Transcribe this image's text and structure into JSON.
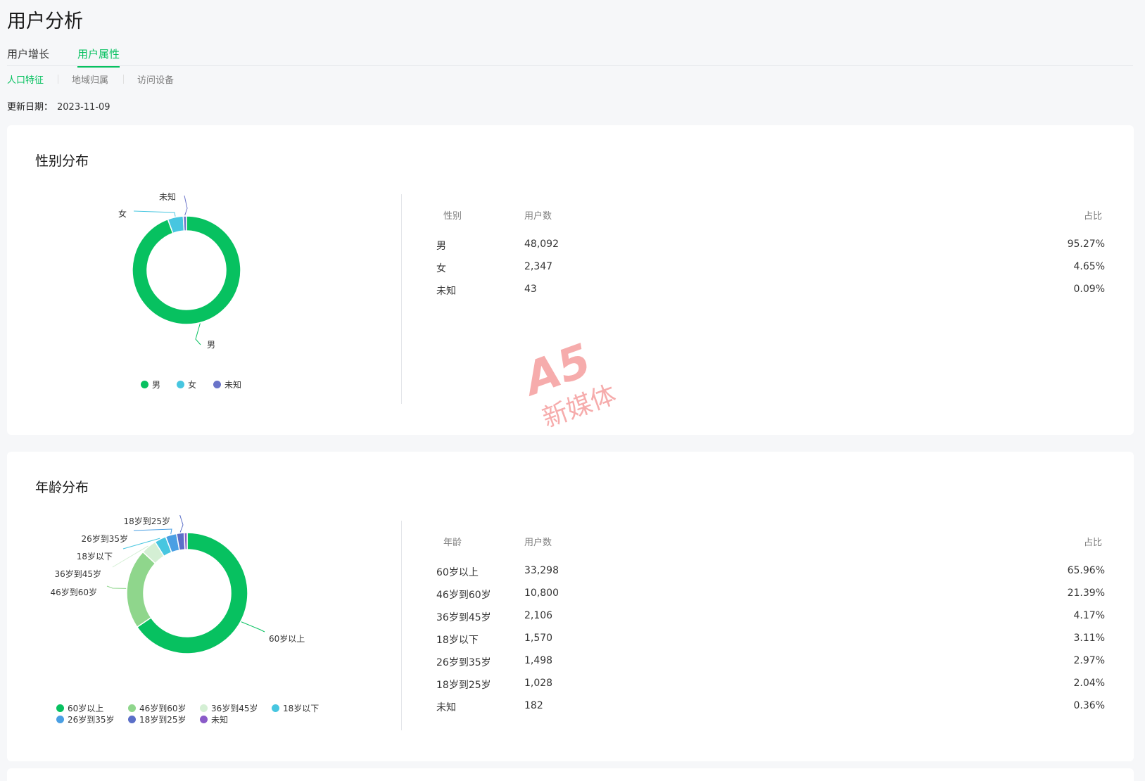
{
  "page": {
    "title": "用户分析"
  },
  "main_tabs": [
    {
      "label": "用户增长",
      "active": false
    },
    {
      "label": "用户属性",
      "active": true
    }
  ],
  "sub_tabs": [
    {
      "label": "人口特征",
      "active": true
    },
    {
      "label": "地域归属",
      "active": false
    },
    {
      "label": "访问设备",
      "active": false
    }
  ],
  "update": {
    "label": "更新日期：",
    "date": "2023-11-09"
  },
  "gender": {
    "title": "性别分布",
    "table_headers": {
      "col1": "性别",
      "col2": "用户数",
      "col3": "占比"
    },
    "rows": [
      {
        "name": "男",
        "count": "48,092",
        "pct": "95.27%"
      },
      {
        "name": "女",
        "count": "2,347",
        "pct": "4.65%"
      },
      {
        "name": "未知",
        "count": "43",
        "pct": "0.09%"
      }
    ],
    "legend": [
      "男",
      "女",
      "未知"
    ]
  },
  "age": {
    "title": "年龄分布",
    "table_headers": {
      "col1": "年龄",
      "col2": "用户数",
      "col3": "占比"
    },
    "rows": [
      {
        "name": "60岁以上",
        "count": "33,298",
        "pct": "65.96%"
      },
      {
        "name": "46岁到60岁",
        "count": "10,800",
        "pct": "21.39%"
      },
      {
        "name": "36岁到45岁",
        "count": "2,106",
        "pct": "4.17%"
      },
      {
        "name": "18岁以下",
        "count": "1,570",
        "pct": "3.11%"
      },
      {
        "name": "26岁到35岁",
        "count": "1,498",
        "pct": "2.97%"
      },
      {
        "name": "18岁到25岁",
        "count": "1,028",
        "pct": "2.04%"
      },
      {
        "name": "未知",
        "count": "182",
        "pct": "0.36%"
      }
    ],
    "legend": [
      "60岁以上",
      "46岁到60岁",
      "36岁到45岁",
      "18岁以下",
      "26岁到35岁",
      "18岁到25岁",
      "未知"
    ]
  },
  "chart_data": [
    {
      "type": "pie",
      "title": "性别分布",
      "categories": [
        "男",
        "女",
        "未知"
      ],
      "values": [
        48092,
        2347,
        43
      ],
      "colors": [
        "#07c160",
        "#47c6e0",
        "#6a74c9"
      ],
      "legend": "bottom"
    },
    {
      "type": "pie",
      "title": "年龄分布",
      "categories": [
        "60岁以上",
        "46岁到60岁",
        "36岁到45岁",
        "18岁以下",
        "26岁到35岁",
        "18岁到25岁",
        "未知"
      ],
      "values": [
        33298,
        10800,
        2106,
        1570,
        1498,
        1028,
        182
      ],
      "colors": [
        "#07c160",
        "#8fd68c",
        "#d4efd4",
        "#47c6e0",
        "#4a9fe3",
        "#5b6fc8",
        "#8a5bc8"
      ],
      "legend": "bottom"
    }
  ],
  "watermark": {
    "brand": "A5",
    "text": "新媒体"
  },
  "colors": {
    "accent": "#07c160"
  }
}
